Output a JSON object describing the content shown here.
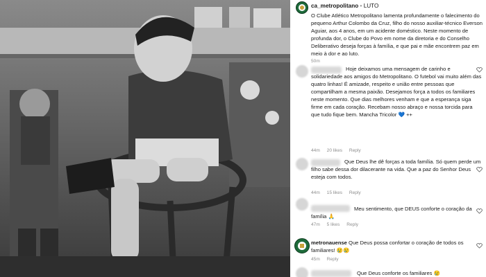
{
  "post": {
    "username": "ca_metropolitano",
    "tag": "LUTO",
    "caption": "O Clube Atlético Metropolitano lamenta profundamente o falecimento do pequeno Arthur Colombo da Cruz, filho do nosso auxiliar-técnico Everson Aguiar, aos 4 anos, em um acidente doméstico. Neste momento de profunda dor, o Clube do Povo em nome da diretoria e do Conselho Deliberativo deseja forças à família, e que pai e mãe encontrem paz em meio à dor e ao luto.",
    "time": "50m"
  },
  "comments": [
    {
      "username": "",
      "text": "Hoje deixamos uma mensagem de carinho e solidariedade aos amigos do Metropolitano. O futebol vai muito além das quatro linhas! É amizade, respeito e união entre pessoas que compartilham a mesma paixão. Desejamos força a todos os familiares neste momento. Que dias melhores venham e que a esperança siga firme em cada coração. Recebam nosso abraço e nossa torcida para que tudo fique bem. Manchа Tricolor 💙 ++",
      "time": "44m",
      "likes": "20 likes",
      "reply": "Reply"
    },
    {
      "username": "",
      "text": "Que Deus lhe dê forças a toda família. Só quem perde um filho sabe dessa dor dilacerante na vida. Que a paz do Senhor Deus esteja com todos.",
      "time": "44m",
      "likes": "15 likes",
      "reply": "Reply"
    },
    {
      "username": "",
      "text": "Meu sentimento, que DEUS conforte o coração da família 🙏",
      "time": "47m",
      "likes": "5 likes",
      "reply": "Reply"
    },
    {
      "username": "metronauense",
      "text": "Que Deus possa confortar o coração de todos os familiares! 😢😢",
      "time": "45m",
      "likes": "",
      "reply": "Reply"
    },
    {
      "username": "",
      "text": "Que Deus conforte os familiares 😢",
      "time": "",
      "likes": "",
      "reply": ""
    }
  ],
  "icons": {
    "like": "heart-icon",
    "avatar": "club-crest-icon"
  },
  "colors": {
    "text": "#1a1a1a",
    "meta": "#8e8e8e",
    "link": "#3b5b8a"
  }
}
